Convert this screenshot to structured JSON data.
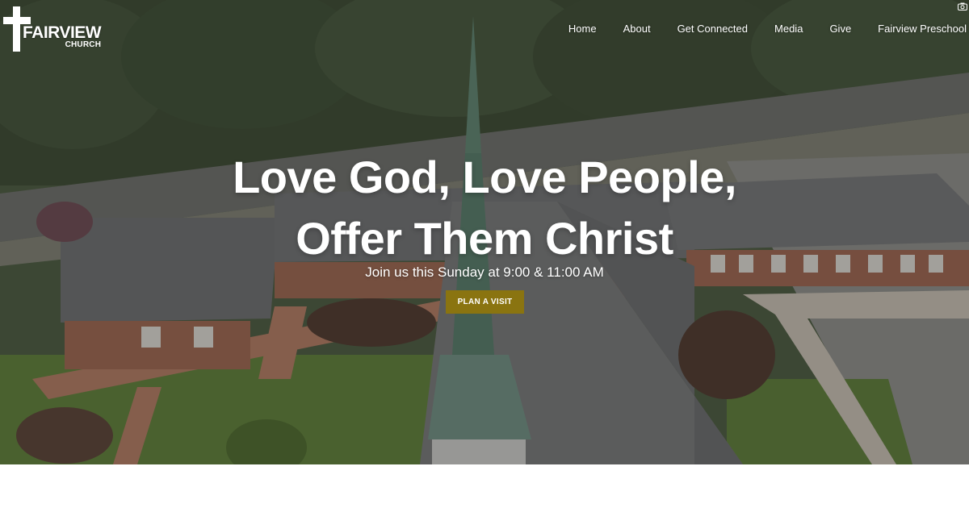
{
  "brand": {
    "name": "FAIRVIEW",
    "subname": "CHURCH"
  },
  "nav": {
    "items": [
      "Home",
      "About",
      "Get Connected",
      "Media",
      "Give",
      "Fairview Preschool"
    ]
  },
  "hero": {
    "headline_line1": "Love God, Love People,",
    "headline_line2": "Offer Them Christ",
    "subheading": "Join us this Sunday at 9:00 & 11:00 AM",
    "cta_label": "PLAN A VISIT"
  },
  "colors": {
    "cta_background": "#8a7410",
    "text": "#ffffff",
    "page_background": "#ffffff"
  },
  "icons": {
    "logo": "cross-icon",
    "top_right": "camera-icon"
  }
}
